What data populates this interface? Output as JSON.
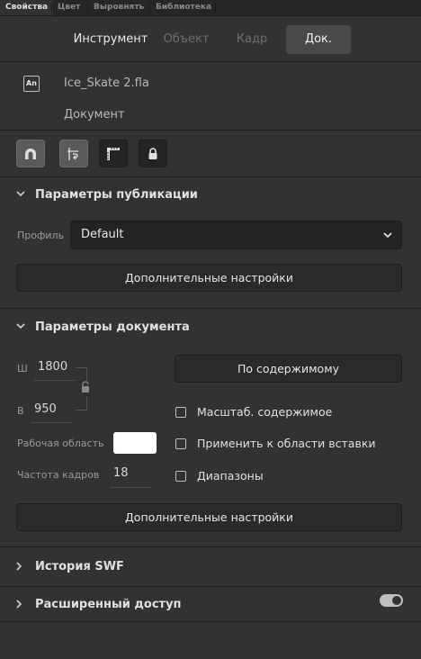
{
  "panel_tabs": [
    "Свойства",
    "Цвет",
    "Выровнять",
    "Библиотека"
  ],
  "mode_tabs": [
    "Инструмент",
    "Объект",
    "Кадр",
    "Док."
  ],
  "document": {
    "icon_text": "An",
    "filename": "Ice_Skate 2.fla",
    "kind": "Документ"
  },
  "toolbar_icons": [
    "snap-magnet-icon",
    "snap-to-guides-icon",
    "ruler-corner-icon",
    "lock-icon"
  ],
  "publish_section": {
    "title": "Параметры публикации",
    "profile_label": "Профиль",
    "profile_value": "Default",
    "advanced_button": "Дополнительные настройки"
  },
  "document_section": {
    "title": "Параметры документа",
    "width_label": "Ш",
    "width_value": "1800",
    "height_label": "В",
    "height_value": "950",
    "fit_button": "По содержимому",
    "stage_label": "Рабочая область",
    "stage_color": "#ffffff",
    "fps_label": "Частота кадров",
    "fps_value": "18",
    "scale_checkbox": "Масштаб. содержимое",
    "paste_checkbox": "Применить к области вставки",
    "spans_checkbox": "Диапазоны",
    "advanced_button": "Дополнительные настройки"
  },
  "swf_history": {
    "title": "История SWF"
  },
  "accessibility": {
    "title": "Расширенный доступ",
    "toggle_on": true
  }
}
